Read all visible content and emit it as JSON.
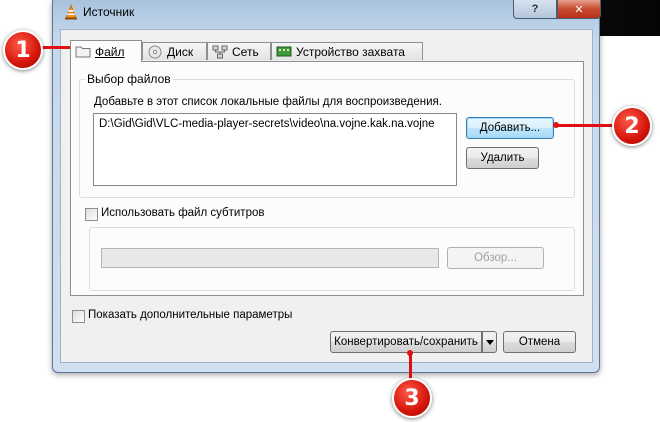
{
  "window": {
    "title": "Источник",
    "help_label": "?",
    "close_label": "✕"
  },
  "tabs": [
    {
      "label": "Файл",
      "icon": "folder-icon",
      "active": true
    },
    {
      "label": "Диск",
      "icon": "disc-icon",
      "active": false
    },
    {
      "label": "Сеть",
      "icon": "network-icon",
      "active": false
    },
    {
      "label": "Устройство захвата",
      "icon": "capture-device-icon",
      "active": false
    }
  ],
  "file_selection": {
    "group_label": "Выбор файлов",
    "description": "Добавьте в этот список локальные файлы для воспроизведения.",
    "files": [
      "D:\\Gid\\Gid\\VLC-media-player-secrets\\video\\na.vojne.kak.na.vojne"
    ],
    "add_label": "Добавить...",
    "remove_label": "Удалить"
  },
  "subtitles": {
    "checkbox_label": "Использовать файл субтитров",
    "checked": false,
    "browse_label": "Обзор..."
  },
  "footer": {
    "show_more_label": "Показать дополнительные параметры",
    "convert_label": "Конвертировать/сохранить",
    "cancel_label": "Отмена"
  },
  "annotations": [
    "1",
    "2",
    "3"
  ]
}
